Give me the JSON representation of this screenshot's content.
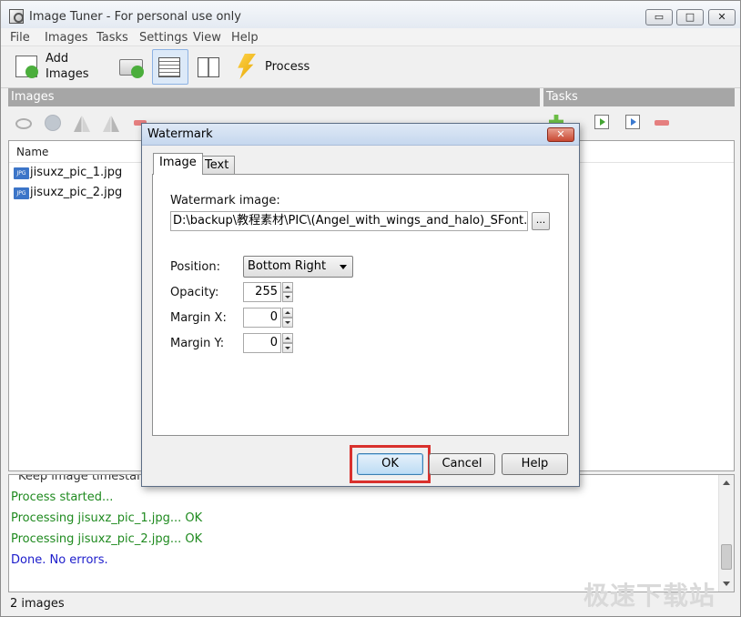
{
  "window": {
    "title": "Image Tuner - For personal use only",
    "controls": {
      "minimize": "▭",
      "maximize": "□",
      "close": "✕"
    }
  },
  "menu": [
    "File",
    "Images",
    "Tasks",
    "Settings",
    "View",
    "Help"
  ],
  "toolbar": {
    "add_images_line1": "Add",
    "add_images_line2": "Images",
    "process_label": "Process"
  },
  "panels": {
    "images_header": "Images",
    "tasks_header": "Tasks"
  },
  "list": {
    "column_name": "Name",
    "files": [
      {
        "icon": "JPG",
        "name": "jisuxz_pic_1.jpg"
      },
      {
        "icon": "JPG",
        "name": "jisuxz_pic_2.jpg"
      }
    ]
  },
  "log": {
    "lines": [
      {
        "text": "Keep image timestamp",
        "color": "gray"
      },
      {
        "text": "Process started...",
        "color": "green"
      },
      {
        "text": "Processing jisuxz_pic_1.jpg... OK",
        "color": "green"
      },
      {
        "text": "Processing jisuxz_pic_2.jpg... OK",
        "color": "green"
      },
      {
        "text": "Done. No errors.",
        "color": "blue"
      }
    ]
  },
  "status": {
    "text": "2 images"
  },
  "site_logo": "极速下载站",
  "dialog": {
    "title": "Watermark",
    "close": "✕",
    "tabs": [
      "Image",
      "Text"
    ],
    "watermark_image_label": "Watermark image:",
    "watermark_image_path": "D:\\backup\\教程素材\\PIC\\(Angel_with_wings_and_halo)_SFont.CN.jpg",
    "browse_label": "...",
    "position_label": "Position:",
    "position_value": "Bottom Right",
    "opacity_label": "Opacity:",
    "opacity_value": "255",
    "margin_x_label": "Margin X:",
    "margin_x_value": "0",
    "margin_y_label": "Margin Y:",
    "margin_y_value": "0",
    "ok_label": "OK",
    "cancel_label": "Cancel",
    "help_label": "Help"
  },
  "colors": {
    "log_green": "#1f8a1f",
    "log_blue": "#1c1ccb",
    "panel_header": "#a6a6a6",
    "highlight": "#d9312d",
    "jpg_icon": "#3c75c8"
  }
}
